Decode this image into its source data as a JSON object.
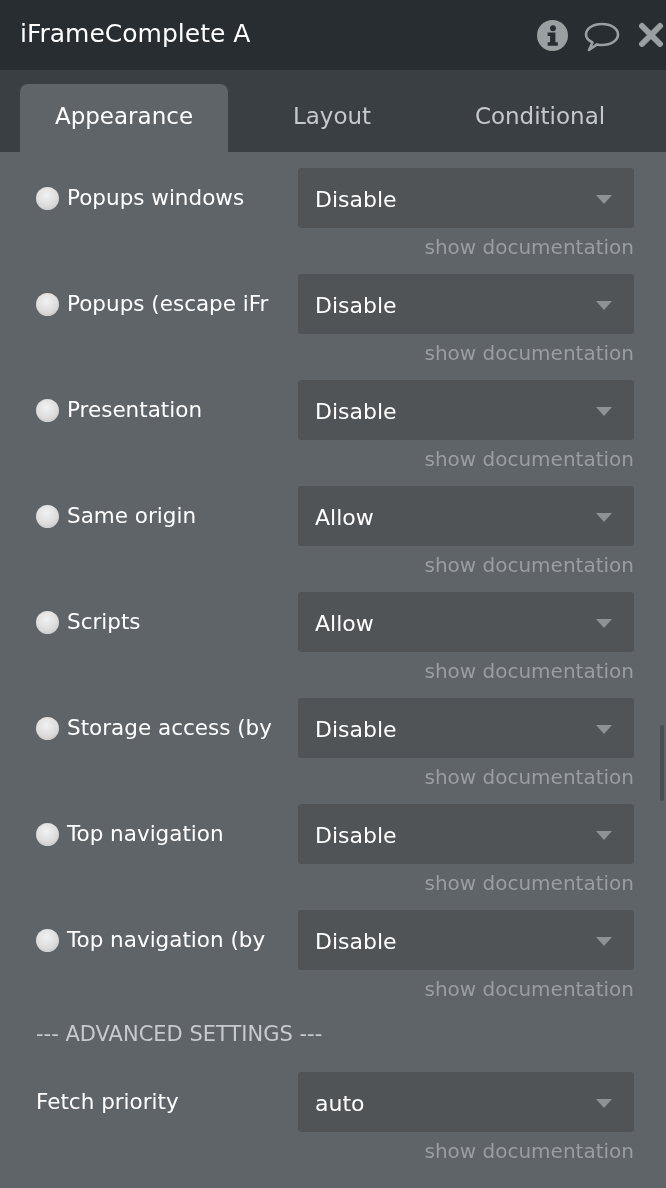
{
  "window": {
    "title": "iFrameComplete A"
  },
  "tabs": [
    {
      "label": "Appearance",
      "selected": true
    },
    {
      "label": "Layout",
      "selected": false
    },
    {
      "label": "Conditional",
      "selected": false
    }
  ],
  "settings": [
    {
      "label": "Popups windows",
      "checked": false,
      "value": "Disable",
      "link": "show documentation"
    },
    {
      "label": "Popups (escape iFr",
      "checked": false,
      "value": "Disable",
      "link": "show documentation"
    },
    {
      "label": "Presentation",
      "checked": false,
      "value": "Disable",
      "link": "show documentation"
    },
    {
      "label": "Same origin",
      "checked": false,
      "value": "Allow",
      "link": "show documentation"
    },
    {
      "label": "Scripts",
      "checked": false,
      "value": "Allow",
      "link": "show documentation"
    },
    {
      "label": "Storage access (by",
      "checked": false,
      "value": "Disable",
      "link": "show documentation"
    },
    {
      "label": "Top navigation",
      "checked": false,
      "value": "Disable",
      "link": "show documentation"
    },
    {
      "label": "Top navigation (by",
      "checked": false,
      "value": "Disable",
      "link": "show documentation"
    }
  ],
  "section_heading": "--- ADVANCED SETTINGS ---",
  "advanced_settings": [
    {
      "label": "Fetch priority",
      "value": "auto",
      "link": "show documentation"
    }
  ]
}
